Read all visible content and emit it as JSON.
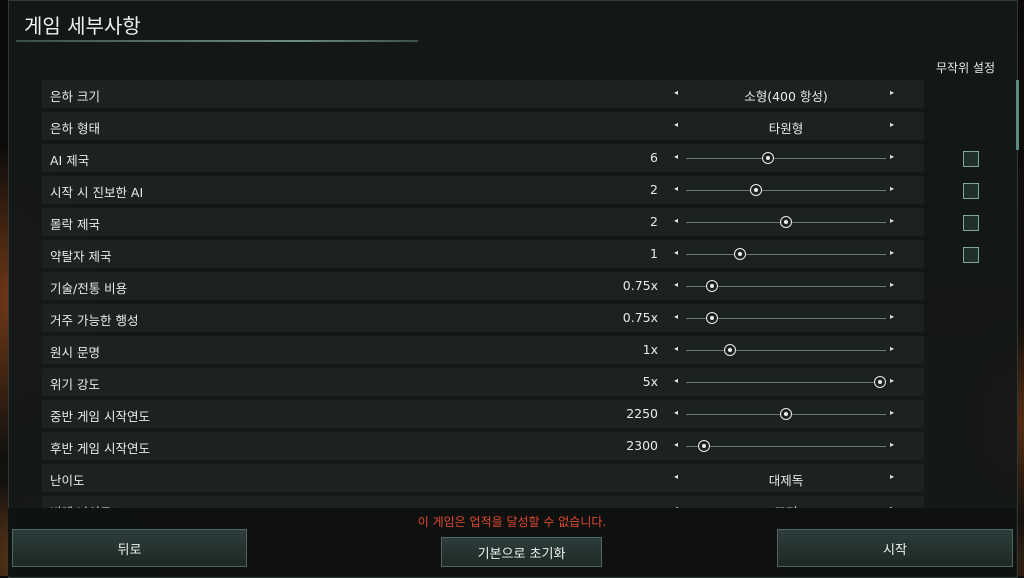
{
  "window": {
    "title": "게임 세부사항"
  },
  "random_header": "무작위 설정",
  "settings": [
    {
      "label": "은하 크기",
      "kind": "select",
      "value": "소형(400 항성)"
    },
    {
      "label": "은하 형태",
      "kind": "select",
      "value": "타원형"
    },
    {
      "label": "AI 제국",
      "kind": "slider",
      "value": "6",
      "level": 0.41,
      "random": true
    },
    {
      "label": "시작 시 진보한 AI",
      "kind": "slider",
      "value": "2",
      "level": 0.35,
      "random": true
    },
    {
      "label": "몰락 제국",
      "kind": "slider",
      "value": "2",
      "level": 0.5,
      "random": true
    },
    {
      "label": "약탈자 제국",
      "kind": "slider",
      "value": "1",
      "level": 0.27,
      "random": true
    },
    {
      "label": "기술/전통 비용",
      "kind": "slider",
      "value": "0.75x",
      "level": 0.13
    },
    {
      "label": "거주 가능한 행성",
      "kind": "slider",
      "value": "0.75x",
      "level": 0.13
    },
    {
      "label": "원시 문명",
      "kind": "slider",
      "value": "1x",
      "level": 0.22
    },
    {
      "label": "위기 강도",
      "kind": "slider",
      "value": "5x",
      "level": 0.97
    },
    {
      "label": "중반 게임 시작연도",
      "kind": "slider",
      "value": "2250",
      "level": 0.5
    },
    {
      "label": "후반 게임 시작연도",
      "kind": "slider",
      "value": "2300",
      "level": 0.09
    },
    {
      "label": "난이도",
      "kind": "select",
      "value": "대제독"
    },
    {
      "label": "비례 난이도",
      "kind": "select",
      "value": "끄기"
    }
  ],
  "warning": "이 게임은 업적을 달성할 수 없습니다.",
  "buttons": {
    "back": "뒤로",
    "reset": "기본으로 초기화",
    "start": "시작"
  },
  "icons": {
    "left": "◂",
    "right": "▸"
  },
  "colors": {
    "warning": "#e2492f",
    "accent": "#6a8c84"
  }
}
